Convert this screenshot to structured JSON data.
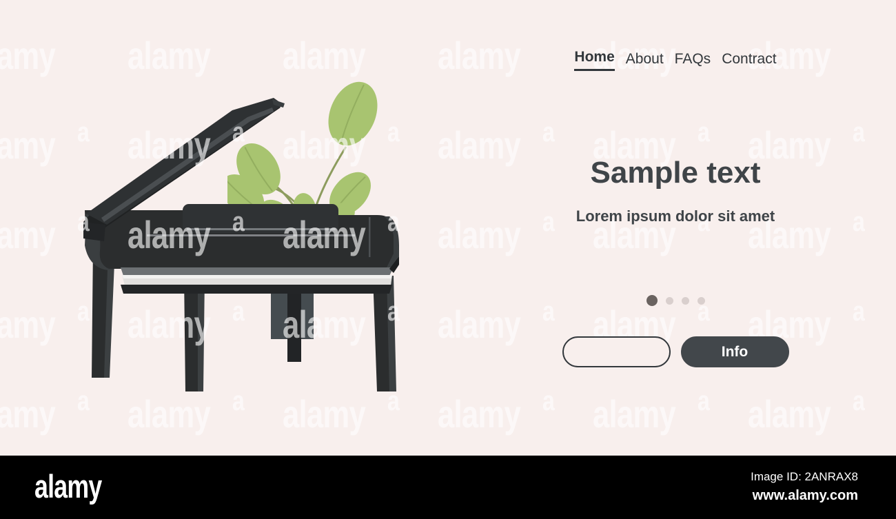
{
  "page": {
    "background_color": "#f8efed",
    "accent_dark": "#3f4448",
    "leaf_green": "#a8c470",
    "piano_black": "#2b2d2e"
  },
  "nav": {
    "items": [
      {
        "label": "Home",
        "active": true
      },
      {
        "label": "About",
        "active": false
      },
      {
        "label": "FAQs",
        "active": false
      },
      {
        "label": "Contract",
        "active": false
      }
    ]
  },
  "hero": {
    "headline": "Sample text",
    "subhead": "Lorem ipsum dolor sit amet"
  },
  "carousel": {
    "total_dots": 4,
    "active_index": 0
  },
  "buttons": {
    "outline_label": "",
    "solid_label": "Info"
  },
  "illustration": {
    "subject": "grand-piano",
    "secondary_subject": "potted-plant-leaves",
    "leaf_count": 7
  },
  "watermark": {
    "word": "alamy",
    "glyph": "a"
  },
  "footer": {
    "logo": "alamy",
    "image_id": "Image ID: 2ANRAX8",
    "url": "www.alamy.com"
  }
}
